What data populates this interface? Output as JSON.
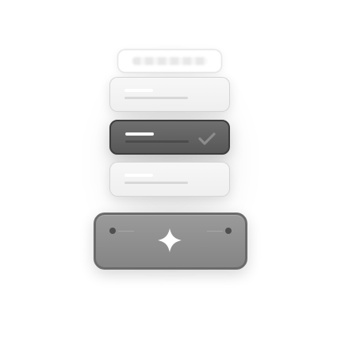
{
  "colors": {
    "light_card": "#f3f3f3",
    "selected_card": "#636363",
    "selected_border": "#3d3d3d",
    "button": "#8f8f8f",
    "button_border": "#6b6b6b",
    "accent_line": "#ffffff"
  },
  "list": {
    "items": [
      {
        "state": "default"
      },
      {
        "state": "selected",
        "icon": "check-icon"
      },
      {
        "state": "default"
      }
    ]
  },
  "action": {
    "icon": "sparkle-icon"
  }
}
